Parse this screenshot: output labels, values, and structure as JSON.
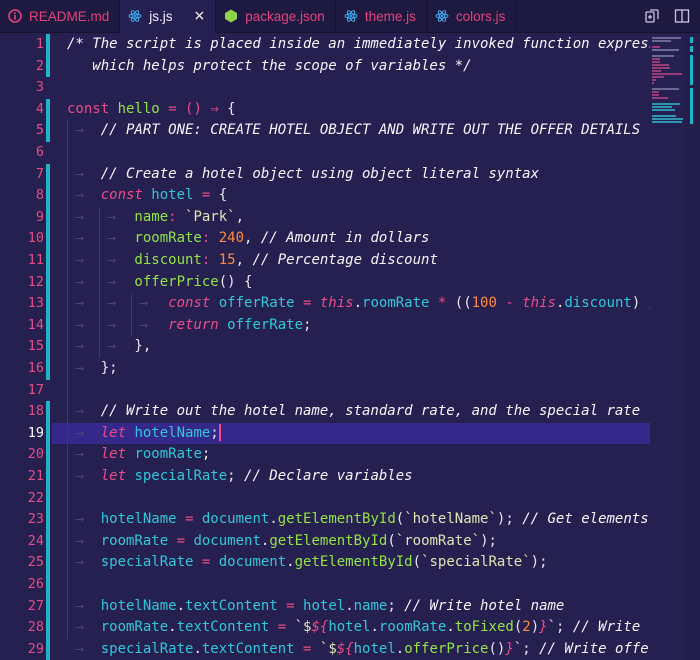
{
  "tabs": [
    {
      "label": "README.md",
      "icon": "info-icon",
      "active": false
    },
    {
      "label": "js.js",
      "icon": "react-icon",
      "active": true,
      "close": "×"
    },
    {
      "label": "package.json",
      "icon": "nodejs-icon",
      "active": false
    },
    {
      "label": "theme.js",
      "icon": "react-icon",
      "active": false
    },
    {
      "label": "colors.js",
      "icon": "react-icon",
      "active": false
    }
  ],
  "actions": [
    "compare-changes-icon",
    "split-editor-icon"
  ],
  "colors": {
    "accent": "#ea4c89",
    "modified": "#1fb4c8",
    "background": "#262050",
    "tabbar": "#1e1940",
    "current_line": "#35288a"
  },
  "editor": {
    "current_line": 19,
    "line_numbers": [
      "1",
      "2",
      "3",
      "4",
      "5",
      "6",
      "7",
      "8",
      "9",
      "10",
      "11",
      "12",
      "13",
      "14",
      "15",
      "16",
      "17",
      "18",
      "19",
      "20",
      "21",
      "22",
      "23",
      "24",
      "25",
      "26",
      "27",
      "28",
      "29"
    ],
    "lines": [
      [
        [
          "c",
          "/* The script is placed inside an immediately invoked function expression"
        ]
      ],
      [
        [
          "c",
          "   which helps protect the scope of variables */"
        ]
      ],
      [],
      [
        [
          "k",
          "const "
        ],
        [
          "f",
          "hello"
        ],
        [
          "p",
          " = () "
        ],
        [
          "k",
          "⇒"
        ],
        [
          "plain",
          " {"
        ]
      ],
      [
        [
          "c",
          "    // PART ONE: CREATE HOTEL OBJECT AND WRITE OUT THE OFFER DETAILS"
        ]
      ],
      [],
      [
        [
          "c",
          "    // Create a hotel object using object literal syntax"
        ]
      ],
      [
        [
          "ki",
          "    const "
        ],
        [
          "v",
          "hotel"
        ],
        [
          "p",
          " = "
        ],
        [
          "plain",
          "{"
        ]
      ],
      [
        [
          "f",
          "        name"
        ],
        [
          "p",
          ": "
        ],
        [
          "s",
          "`Park`"
        ],
        [
          "plain",
          ","
        ]
      ],
      [
        [
          "f",
          "        roomRate"
        ],
        [
          "p",
          ": "
        ],
        [
          "n",
          "240"
        ],
        [
          "plain",
          ", "
        ],
        [
          "c",
          "// Amount in dollars"
        ]
      ],
      [
        [
          "f",
          "        discount"
        ],
        [
          "p",
          ": "
        ],
        [
          "n",
          "15"
        ],
        [
          "plain",
          ", "
        ],
        [
          "c",
          "// Percentage discount"
        ]
      ],
      [
        [
          "f",
          "        offerPrice"
        ],
        [
          "plain",
          "() {"
        ]
      ],
      [
        [
          "ki",
          "            const "
        ],
        [
          "v",
          "offerRate"
        ],
        [
          "p",
          " = "
        ],
        [
          "ki",
          "this"
        ],
        [
          "plain",
          "."
        ],
        [
          "v",
          "roomRate"
        ],
        [
          "p",
          " * "
        ],
        [
          "plain",
          "(("
        ],
        [
          "n",
          "100"
        ],
        [
          "p",
          " - "
        ],
        [
          "ki",
          "this"
        ],
        [
          "plain",
          "."
        ],
        [
          "v",
          "discount"
        ],
        [
          "plain",
          ") "
        ],
        [
          "p",
          "/ "
        ],
        [
          "n",
          "100"
        ]
      ],
      [
        [
          "ki",
          "            return "
        ],
        [
          "v",
          "offerRate"
        ],
        [
          "plain",
          ";"
        ]
      ],
      [
        [
          "plain",
          "        },"
        ]
      ],
      [
        [
          "plain",
          "    };"
        ]
      ],
      [],
      [
        [
          "c",
          "    // Write out the hotel name, standard rate, and the special rate"
        ]
      ],
      [
        [
          "ki",
          "    let "
        ],
        [
          "v",
          "hotelName"
        ],
        [
          "plain",
          ";"
        ]
      ],
      [
        [
          "ki",
          "    let "
        ],
        [
          "v",
          "roomRate"
        ],
        [
          "plain",
          ";"
        ]
      ],
      [
        [
          "ki",
          "    let "
        ],
        [
          "v",
          "specialRate"
        ],
        [
          "plain",
          "; "
        ],
        [
          "c",
          "// Declare variables"
        ]
      ],
      [],
      [
        [
          "v",
          "    hotelName"
        ],
        [
          "p",
          " = "
        ],
        [
          "v",
          "document"
        ],
        [
          "plain",
          "."
        ],
        [
          "f",
          "getElementById"
        ],
        [
          "plain",
          "("
        ],
        [
          "s",
          "`hotelName`"
        ],
        [
          "plain",
          "); "
        ],
        [
          "c",
          "// Get elements"
        ]
      ],
      [
        [
          "v",
          "    roomRate"
        ],
        [
          "p",
          " = "
        ],
        [
          "v",
          "document"
        ],
        [
          "plain",
          "."
        ],
        [
          "f",
          "getElementById"
        ],
        [
          "plain",
          "("
        ],
        [
          "s",
          "`roomRate`"
        ],
        [
          "plain",
          ");"
        ]
      ],
      [
        [
          "v",
          "    specialRate"
        ],
        [
          "p",
          " = "
        ],
        [
          "v",
          "document"
        ],
        [
          "plain",
          "."
        ],
        [
          "f",
          "getElementById"
        ],
        [
          "plain",
          "("
        ],
        [
          "s",
          "`specialRate`"
        ],
        [
          "plain",
          ");"
        ]
      ],
      [],
      [
        [
          "v",
          "    hotelName"
        ],
        [
          "plain",
          "."
        ],
        [
          "v",
          "textContent"
        ],
        [
          "p",
          " = "
        ],
        [
          "v",
          "hotel"
        ],
        [
          "plain",
          "."
        ],
        [
          "v",
          "name"
        ],
        [
          "plain",
          "; "
        ],
        [
          "c",
          "// Write hotel name"
        ]
      ],
      [
        [
          "v",
          "    roomRate"
        ],
        [
          "plain",
          "."
        ],
        [
          "v",
          "textContent"
        ],
        [
          "p",
          " = "
        ],
        [
          "s",
          "`$"
        ],
        [
          "ki",
          "${"
        ],
        [
          "v",
          "hotel"
        ],
        [
          "plain",
          "."
        ],
        [
          "v",
          "roomRate"
        ],
        [
          "plain",
          "."
        ],
        [
          "f",
          "toFixed"
        ],
        [
          "plain",
          "("
        ],
        [
          "n",
          "2"
        ],
        [
          "plain",
          ")"
        ],
        [
          "ki",
          "}"
        ],
        [
          "s",
          "`"
        ],
        [
          "plain",
          "; "
        ],
        [
          "c",
          "// Write room rate"
        ]
      ],
      [
        [
          "v",
          "    specialRate"
        ],
        [
          "plain",
          "."
        ],
        [
          "v",
          "textContent"
        ],
        [
          "p",
          " = "
        ],
        [
          "s",
          "`$"
        ],
        [
          "ki",
          "${"
        ],
        [
          "v",
          "hotel"
        ],
        [
          "plain",
          "."
        ],
        [
          "f",
          "offerPrice"
        ],
        [
          "plain",
          "()"
        ],
        [
          "ki",
          "}"
        ],
        [
          "s",
          "`"
        ],
        [
          "plain",
          "; "
        ],
        [
          "c",
          "// Write offer price"
        ]
      ]
    ]
  }
}
